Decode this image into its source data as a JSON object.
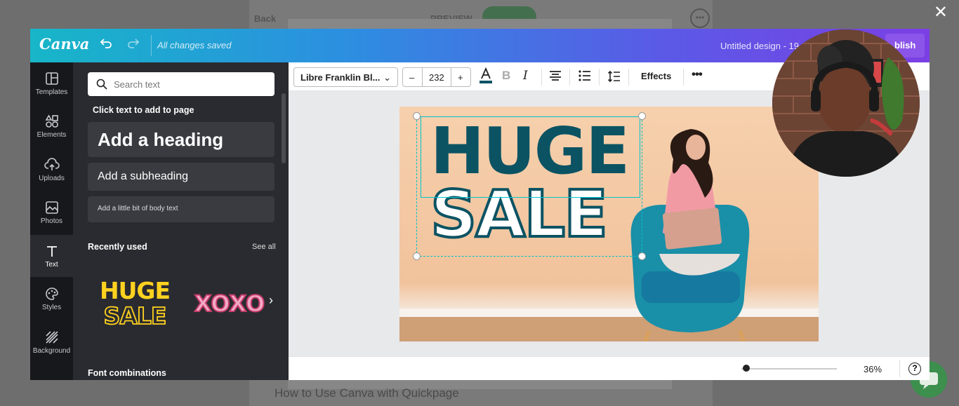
{
  "background": {
    "back_label": "Back",
    "preview_label": "PREVIEW",
    "caption": "How to Use Canva with Quickpage",
    "more_label": "•••"
  },
  "overlay": {
    "close_label": "✕"
  },
  "canva": {
    "logo": "Canva",
    "status": "All changes saved",
    "design_title": "Untitled design - 19",
    "publish_label": "blish"
  },
  "sidebar": {
    "items": [
      {
        "label": "Templates",
        "icon": "templates-icon"
      },
      {
        "label": "Elements",
        "icon": "elements-icon"
      },
      {
        "label": "Uploads",
        "icon": "uploads-icon"
      },
      {
        "label": "Photos",
        "icon": "photos-icon"
      },
      {
        "label": "Text",
        "icon": "text-icon",
        "active": true
      },
      {
        "label": "Styles",
        "icon": "styles-icon"
      },
      {
        "label": "Background",
        "icon": "background-icon"
      }
    ]
  },
  "text_panel": {
    "search_placeholder": "Search text",
    "hint": "Click text to add to page",
    "heading": "Add a heading",
    "subheading": "Add a subheading",
    "body": "Add a little bit of body text",
    "recently_used": "Recently used",
    "see_all": "See all",
    "recent_items": [
      {
        "line1": "HUGE",
        "line2": "SALE"
      },
      {
        "line1": "XOXO"
      }
    ],
    "font_combinations": "Font combinations"
  },
  "toolbar": {
    "font": "Libre Franklin Bl...",
    "size": "232",
    "minus": "–",
    "plus": "+",
    "effects": "Effects",
    "more": "•••",
    "bold": "B",
    "italic": "I"
  },
  "design": {
    "line1": "HUGE",
    "line2": "SALE",
    "text_color": "#0b5363"
  },
  "footer": {
    "zoom": "36%",
    "zoom_level": 0.05,
    "help": "?"
  },
  "colors": {
    "gradient_start": "#17b6c8",
    "gradient_end": "#7b3fe4",
    "sidebar_bg": "#17181c",
    "panel_bg": "#2a2b30",
    "selection": "#00c4cc"
  }
}
